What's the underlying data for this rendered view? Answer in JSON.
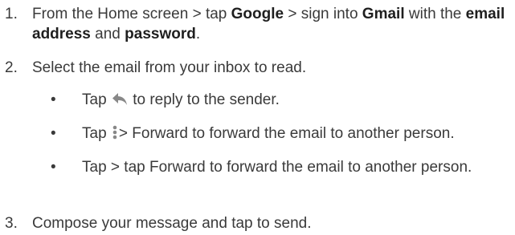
{
  "steps": [
    {
      "number": "1.",
      "text_1": "From the Home screen > tap ",
      "bold_1": "Google",
      "text_2": " > sign into ",
      "bold_2": "Gmail",
      "text_3": " with the ",
      "bold_3": "email address",
      "text_4": " and ",
      "bold_4": "password",
      "text_5": "."
    },
    {
      "number": "2.",
      "text": "Select the email from your inbox to read."
    },
    {
      "number": "3.",
      "text": "Compose your message and tap to send."
    }
  ],
  "bullets": [
    {
      "dot": "•",
      "before": "Tap ",
      "icon": "reply-icon",
      "after": " to reply to the sender."
    },
    {
      "dot": "•",
      "before": "Tap ",
      "icon": "more-vert-icon",
      "after": "> Forward to forward the email to another person."
    },
    {
      "dot": "•",
      "text": "Tap > tap Forward to forward the email to another person."
    }
  ],
  "colors": {
    "text": "#3a3a3a",
    "icon": "#888888"
  }
}
